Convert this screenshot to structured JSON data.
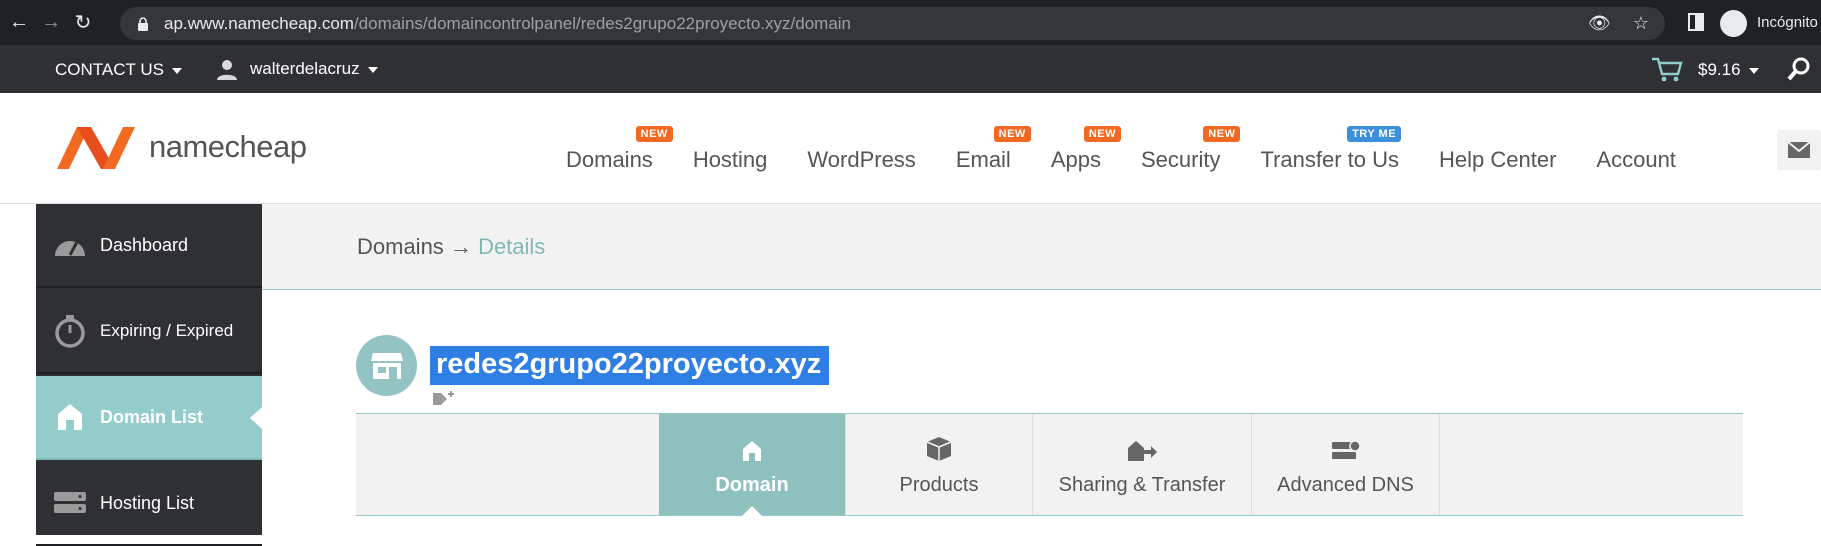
{
  "browser": {
    "url_host": "ap.www.namecheap.com",
    "url_path": "/domains/domaincontrolpanel/redes2grupo22proyecto.xyz/domain",
    "profile_label": "Incógnito"
  },
  "utilbar": {
    "contact_label": "CONTACT US",
    "username": "walterdelacruz",
    "balance": "$9.16"
  },
  "header": {
    "brand": "namecheap",
    "nav": [
      {
        "label": "Domains",
        "badge": "NEW"
      },
      {
        "label": "Hosting",
        "badge": ""
      },
      {
        "label": "WordPress",
        "badge": ""
      },
      {
        "label": "Email",
        "badge": "NEW"
      },
      {
        "label": "Apps",
        "badge": "NEW"
      },
      {
        "label": "Security",
        "badge": "NEW"
      },
      {
        "label": "Transfer to Us",
        "badge": "TRY ME"
      },
      {
        "label": "Help Center",
        "badge": ""
      },
      {
        "label": "Account",
        "badge": ""
      }
    ]
  },
  "sidebar": {
    "items": [
      {
        "label": "Dashboard",
        "icon": "speedometer-icon"
      },
      {
        "label": "Expiring / Expired",
        "icon": "stopwatch-icon"
      },
      {
        "label": "Domain List",
        "icon": "home-icon",
        "active": true
      },
      {
        "label": "Hosting List",
        "icon": "server-icon"
      }
    ]
  },
  "breadcrumb": {
    "parent": "Domains",
    "separator": "→",
    "current": "Details"
  },
  "domain": {
    "name": "redes2grupo22proyecto.xyz"
  },
  "tabs": [
    {
      "label": "Domain",
      "icon": "home-icon",
      "active": true
    },
    {
      "label": "Products",
      "icon": "box-icon"
    },
    {
      "label": "Sharing & Transfer",
      "icon": "transfer-icon"
    },
    {
      "label": "Advanced DNS",
      "icon": "dns-server-icon"
    }
  ],
  "colors": {
    "accent": "#93cccb",
    "dark_bar": "#2f3033",
    "brand_orange": "#f26a21",
    "badge_blue": "#3b8fdb",
    "selection_blue": "#2f7ee4"
  }
}
